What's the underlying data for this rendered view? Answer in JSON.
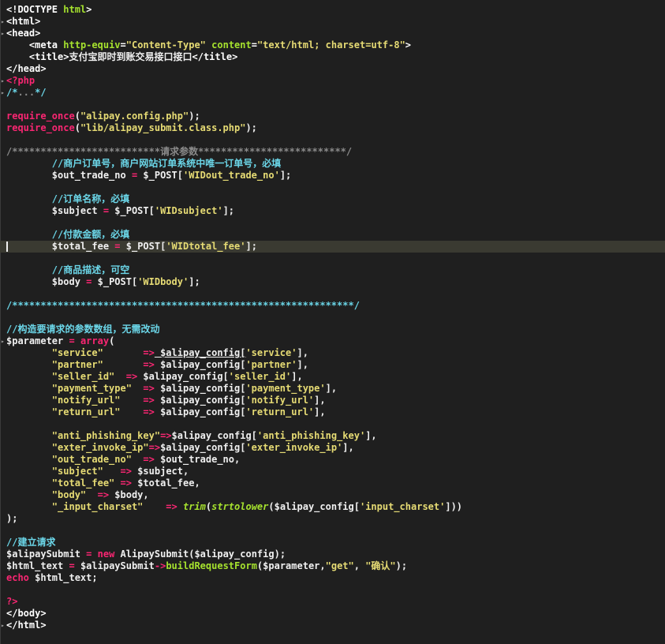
{
  "editor": {
    "language": "php",
    "current_line_index": 20,
    "colors": {
      "background": "#1f1f1f",
      "current_line": "#3a3a31",
      "comment": "#6bd6e8",
      "keyword": "#f92672",
      "string": "#e6db74",
      "attribute": "#a6e22e",
      "text": "#f0f0f0"
    }
  },
  "lines": [
    [
      {
        "c": "t-tag",
        "t": "<!DOCTYPE "
      },
      {
        "c": "t-attr",
        "t": "html"
      },
      {
        "c": "t-tag",
        "t": ">"
      }
    ],
    [
      {
        "c": "t-tag",
        "t": "<html>"
      }
    ],
    [
      {
        "c": "t-tag",
        "t": "<head>"
      }
    ],
    [
      {
        "c": "t-txt",
        "t": "    "
      },
      {
        "c": "t-tag",
        "t": "<meta "
      },
      {
        "c": "t-attr",
        "t": "http-equiv"
      },
      {
        "c": "t-tag",
        "t": "="
      },
      {
        "c": "t-str",
        "t": "\"Content-Type\""
      },
      {
        "c": "t-tag",
        "t": " "
      },
      {
        "c": "t-attr",
        "t": "content"
      },
      {
        "c": "t-tag",
        "t": "="
      },
      {
        "c": "t-str",
        "t": "\"text/html; charset=utf-8\""
      },
      {
        "c": "t-tag",
        "t": ">"
      }
    ],
    [
      {
        "c": "t-txt",
        "t": "    "
      },
      {
        "c": "t-tag",
        "t": "<title>"
      },
      {
        "c": "t-txt",
        "t": "支付宝即时到账交易接口接口"
      },
      {
        "c": "t-tag",
        "t": "</title>"
      }
    ],
    [
      {
        "c": "t-tag",
        "t": "</head>"
      }
    ],
    [
      {
        "c": "t-php",
        "t": "<?php"
      }
    ],
    [
      {
        "c": "t-cmt",
        "t": "/*"
      },
      {
        "c": "t-cmtgray",
        "t": "..."
      },
      {
        "c": "t-cmt",
        "t": "*/"
      }
    ],
    [],
    [
      {
        "c": "t-kw",
        "t": "require_once"
      },
      {
        "c": "t-txt",
        "t": "("
      },
      {
        "c": "t-str",
        "t": "\"alipay.config.php\""
      },
      {
        "c": "t-txt",
        "t": ");"
      }
    ],
    [
      {
        "c": "t-kw",
        "t": "require_once"
      },
      {
        "c": "t-txt",
        "t": "("
      },
      {
        "c": "t-str",
        "t": "\"lib/alipay_submit.class.php\""
      },
      {
        "c": "t-txt",
        "t": ");"
      }
    ],
    [],
    [
      {
        "c": "t-cmtgray",
        "t": "/**************************请求参数**************************/"
      }
    ],
    [
      {
        "c": "t-txt",
        "t": "        "
      },
      {
        "c": "t-cmt",
        "t": "//商户订单号，商户网站订单系统中唯一订单号，必填"
      }
    ],
    [
      {
        "c": "t-txt",
        "t": "        $out_trade_no "
      },
      {
        "c": "t-op",
        "t": "="
      },
      {
        "c": "t-txt",
        "t": " $_POST["
      },
      {
        "c": "t-str",
        "t": "'WIDout_trade_no'"
      },
      {
        "c": "t-txt",
        "t": "];"
      }
    ],
    [],
    [
      {
        "c": "t-txt",
        "t": "        "
      },
      {
        "c": "t-cmt",
        "t": "//订单名称，必填"
      }
    ],
    [
      {
        "c": "t-txt",
        "t": "        $subject "
      },
      {
        "c": "t-op",
        "t": "="
      },
      {
        "c": "t-txt",
        "t": " $_POST["
      },
      {
        "c": "t-str",
        "t": "'WIDsubject'"
      },
      {
        "c": "t-txt",
        "t": "];"
      }
    ],
    [],
    [
      {
        "c": "t-txt",
        "t": "        "
      },
      {
        "c": "t-cmt",
        "t": "//付款金额，必填"
      }
    ],
    [
      {
        "c": "t-txt",
        "t": "        $total_fee "
      },
      {
        "c": "t-op",
        "t": "="
      },
      {
        "c": "t-txt",
        "t": " $_POST["
      },
      {
        "c": "t-str",
        "t": "'WIDtotal_fee'"
      },
      {
        "c": "t-txt",
        "t": "];"
      }
    ],
    [],
    [
      {
        "c": "t-txt",
        "t": "        "
      },
      {
        "c": "t-cmt",
        "t": "//商品描述，可空"
      }
    ],
    [
      {
        "c": "t-txt",
        "t": "        $body "
      },
      {
        "c": "t-op",
        "t": "="
      },
      {
        "c": "t-txt",
        "t": " $_POST["
      },
      {
        "c": "t-str",
        "t": "'WIDbody'"
      },
      {
        "c": "t-txt",
        "t": "];"
      }
    ],
    [],
    [
      {
        "c": "t-cmt",
        "t": "/************************************************************/"
      }
    ],
    [],
    [
      {
        "c": "t-cmt",
        "t": "//构造要请求的参数数组，无需改动"
      }
    ],
    [
      {
        "c": "t-txt",
        "t": "$parameter "
      },
      {
        "c": "t-op",
        "t": "="
      },
      {
        "c": "t-txt",
        "t": " "
      },
      {
        "c": "t-kw",
        "t": "array"
      },
      {
        "c": "t-txt",
        "t": "("
      }
    ],
    [
      {
        "c": "t-txt",
        "t": "        "
      },
      {
        "c": "t-str",
        "t": "\"service\""
      },
      {
        "c": "t-txt",
        "t": "       "
      },
      {
        "c": "t-op",
        "t": "=>"
      },
      {
        "c": "t-txt",
        "t": " $alipay_config["
      },
      {
        "c": "t-str",
        "t": "'service'"
      },
      {
        "c": "t-txt",
        "t": "],"
      }
    ],
    [
      {
        "c": "t-txt",
        "t": "        "
      },
      {
        "c": "t-str",
        "t": "\"partner\""
      },
      {
        "c": "t-txt",
        "t": "       "
      },
      {
        "c": "t-op",
        "t": "=>"
      },
      {
        "c": "t-txt",
        "t": " $alipay_config["
      },
      {
        "c": "t-str",
        "t": "'partner'"
      },
      {
        "c": "t-txt",
        "t": "],"
      }
    ],
    [
      {
        "c": "t-txt",
        "t": "        "
      },
      {
        "c": "t-str",
        "t": "\"seller_id\""
      },
      {
        "c": "t-txt",
        "t": "  "
      },
      {
        "c": "t-op",
        "t": "=>"
      },
      {
        "c": "t-txt",
        "t": " $alipay_config["
      },
      {
        "c": "t-str",
        "t": "'seller_id'"
      },
      {
        "c": "t-txt",
        "t": "],"
      }
    ],
    [
      {
        "c": "t-txt",
        "t": "        "
      },
      {
        "c": "t-str",
        "t": "\"payment_type\""
      },
      {
        "c": "t-txt",
        "t": "  "
      },
      {
        "c": "t-op",
        "t": "=>"
      },
      {
        "c": "t-txt",
        "t": " $alipay_config["
      },
      {
        "c": "t-str",
        "t": "'payment_type'"
      },
      {
        "c": "t-txt",
        "t": "],"
      }
    ],
    [
      {
        "c": "t-txt",
        "t": "        "
      },
      {
        "c": "t-str",
        "t": "\"notify_url\""
      },
      {
        "c": "t-txt",
        "t": "    "
      },
      {
        "c": "t-op",
        "t": "=>"
      },
      {
        "c": "t-txt",
        "t": " $alipay_config["
      },
      {
        "c": "t-str",
        "t": "'notify_url'"
      },
      {
        "c": "t-txt",
        "t": "],"
      }
    ],
    [
      {
        "c": "t-txt",
        "t": "        "
      },
      {
        "c": "t-str",
        "t": "\"return_url\""
      },
      {
        "c": "t-txt",
        "t": "    "
      },
      {
        "c": "t-op",
        "t": "=>"
      },
      {
        "c": "t-txt",
        "t": " $alipay_config["
      },
      {
        "c": "t-str",
        "t": "'return_url'"
      },
      {
        "c": "t-txt",
        "t": "],"
      }
    ],
    [],
    [
      {
        "c": "t-txt",
        "t": "        "
      },
      {
        "c": "t-str",
        "t": "\"anti_phishing_key\""
      },
      {
        "c": "t-op",
        "t": "=>"
      },
      {
        "c": "t-txt",
        "t": "$alipay_config["
      },
      {
        "c": "t-str",
        "t": "'anti_phishing_key'"
      },
      {
        "c": "t-txt",
        "t": "],"
      }
    ],
    [
      {
        "c": "t-txt",
        "t": "        "
      },
      {
        "c": "t-str",
        "t": "\"exter_invoke_ip\""
      },
      {
        "c": "t-op",
        "t": "=>"
      },
      {
        "c": "t-txt",
        "t": "$alipay_config["
      },
      {
        "c": "t-str",
        "t": "'exter_invoke_ip'"
      },
      {
        "c": "t-txt",
        "t": "],"
      }
    ],
    [
      {
        "c": "t-txt",
        "t": "        "
      },
      {
        "c": "t-str",
        "t": "\"out_trade_no\""
      },
      {
        "c": "t-txt",
        "t": "  "
      },
      {
        "c": "t-op",
        "t": "=>"
      },
      {
        "c": "t-txt",
        "t": " $out_trade_no,"
      }
    ],
    [
      {
        "c": "t-txt",
        "t": "        "
      },
      {
        "c": "t-str",
        "t": "\"subject\""
      },
      {
        "c": "t-txt",
        "t": "   "
      },
      {
        "c": "t-op",
        "t": "=>"
      },
      {
        "c": "t-txt",
        "t": " $subject,"
      }
    ],
    [
      {
        "c": "t-txt",
        "t": "        "
      },
      {
        "c": "t-str",
        "t": "\"total_fee\""
      },
      {
        "c": "t-txt",
        "t": " "
      },
      {
        "c": "t-op",
        "t": "=>"
      },
      {
        "c": "t-txt",
        "t": " $total_fee,"
      }
    ],
    [
      {
        "c": "t-txt",
        "t": "        "
      },
      {
        "c": "t-str",
        "t": "\"body\""
      },
      {
        "c": "t-txt",
        "t": "  "
      },
      {
        "c": "t-op",
        "t": "=>"
      },
      {
        "c": "t-txt",
        "t": " $body,"
      }
    ],
    [
      {
        "c": "t-txt",
        "t": "        "
      },
      {
        "c": "t-str",
        "t": "\"_input_charset\""
      },
      {
        "c": "t-txt",
        "t": "    "
      },
      {
        "c": "t-op",
        "t": "=>"
      },
      {
        "c": "t-txt",
        "t": " "
      },
      {
        "c": "t-fn",
        "t": "trim"
      },
      {
        "c": "t-txt",
        "t": "("
      },
      {
        "c": "t-fn",
        "t": "strtolower"
      },
      {
        "c": "t-txt",
        "t": "($alipay_config["
      },
      {
        "c": "t-str",
        "t": "'input_charset'"
      },
      {
        "c": "t-txt",
        "t": "]))"
      }
    ],
    [
      {
        "c": "t-txt",
        "t": ");"
      }
    ],
    [],
    [
      {
        "c": "t-cmt",
        "t": "//建立请求"
      }
    ],
    [
      {
        "c": "t-txt",
        "t": "$alipaySubmit "
      },
      {
        "c": "t-op",
        "t": "="
      },
      {
        "c": "t-txt",
        "t": " "
      },
      {
        "c": "t-kw",
        "t": "new"
      },
      {
        "c": "t-txt",
        "t": " AlipaySubmit($alipay_config);"
      }
    ],
    [
      {
        "c": "t-txt",
        "t": "$html_text "
      },
      {
        "c": "t-op",
        "t": "="
      },
      {
        "c": "t-txt",
        "t": " $alipaySubmit"
      },
      {
        "c": "t-op",
        "t": "->"
      },
      {
        "c": "t-attr",
        "t": "buildRequestForm"
      },
      {
        "c": "t-txt",
        "t": "($parameter,"
      },
      {
        "c": "t-str",
        "t": "\"get\""
      },
      {
        "c": "t-txt",
        "t": ", "
      },
      {
        "c": "t-str",
        "t": "\"确认\""
      },
      {
        "c": "t-txt",
        "t": ");"
      }
    ],
    [
      {
        "c": "t-kw",
        "t": "echo"
      },
      {
        "c": "t-txt",
        "t": " $html_text;"
      }
    ],
    [],
    [
      {
        "c": "t-php",
        "t": "?>"
      }
    ],
    [
      {
        "c": "t-tag",
        "t": "</body>"
      }
    ],
    [
      {
        "c": "t-tag",
        "t": "</html>"
      }
    ]
  ],
  "fold_markers": [
    1,
    2,
    6,
    7,
    28,
    52
  ]
}
